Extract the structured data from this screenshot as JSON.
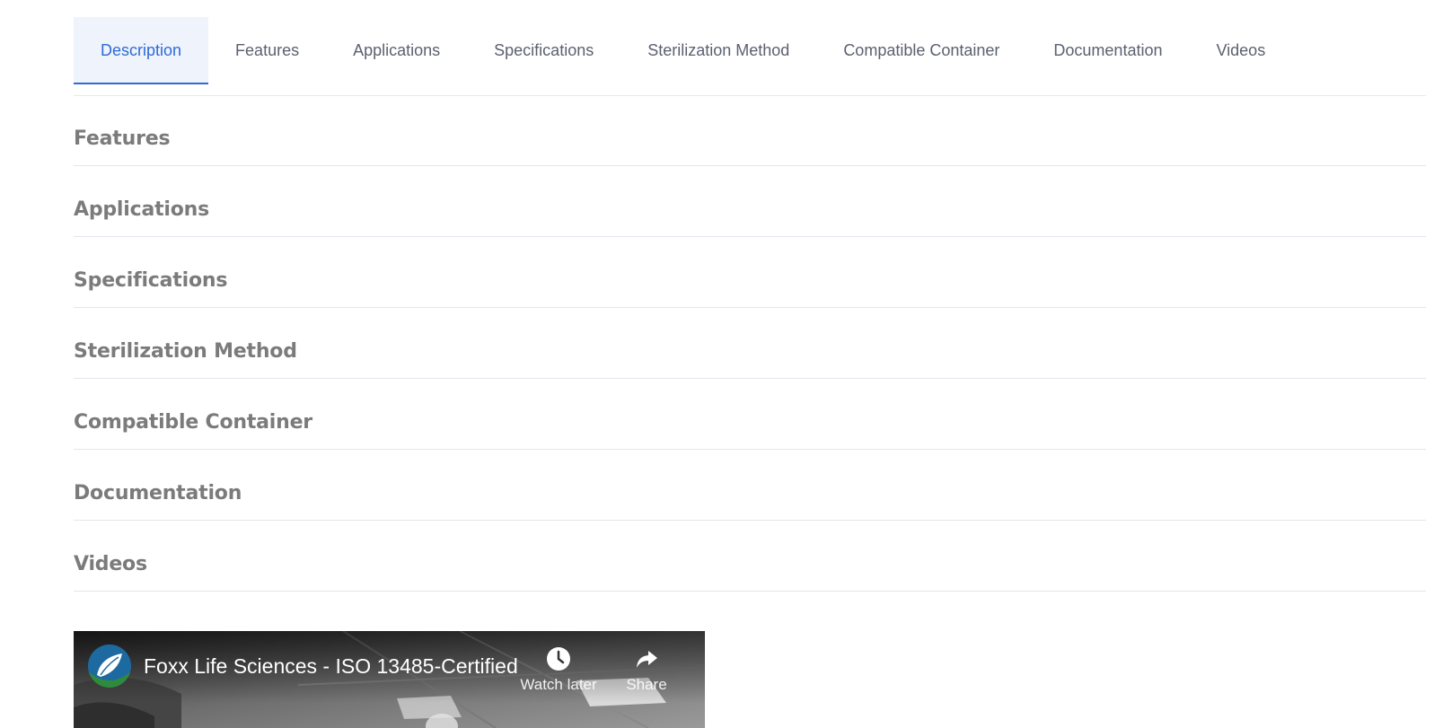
{
  "tabs": [
    {
      "label": "Description",
      "active": true
    },
    {
      "label": "Features",
      "active": false
    },
    {
      "label": "Applications",
      "active": false
    },
    {
      "label": "Specifications",
      "active": false
    },
    {
      "label": "Sterilization Method",
      "active": false
    },
    {
      "label": "Compatible Container",
      "active": false
    },
    {
      "label": "Documentation",
      "active": false
    },
    {
      "label": "Videos",
      "active": false
    }
  ],
  "sections": [
    {
      "title": "Features"
    },
    {
      "title": "Applications"
    },
    {
      "title": "Specifications"
    },
    {
      "title": "Sterilization Method"
    },
    {
      "title": "Compatible Container"
    },
    {
      "title": "Documentation"
    },
    {
      "title": "Videos"
    }
  ],
  "video": {
    "title": "Foxx Life Sciences - ISO 13485-Certified",
    "watch_later_label": "Watch later",
    "share_label": "Share",
    "watch_later_icon": "clock-icon",
    "share_icon": "share-arrow-icon",
    "channel_logo": "channel-logo"
  },
  "colors": {
    "accent": "#2f6bd6",
    "active_tab_bg": "#eef3fc",
    "tab_text": "#5b6170",
    "section_title": "#7b7b7b",
    "divider": "#e2e6ec"
  }
}
